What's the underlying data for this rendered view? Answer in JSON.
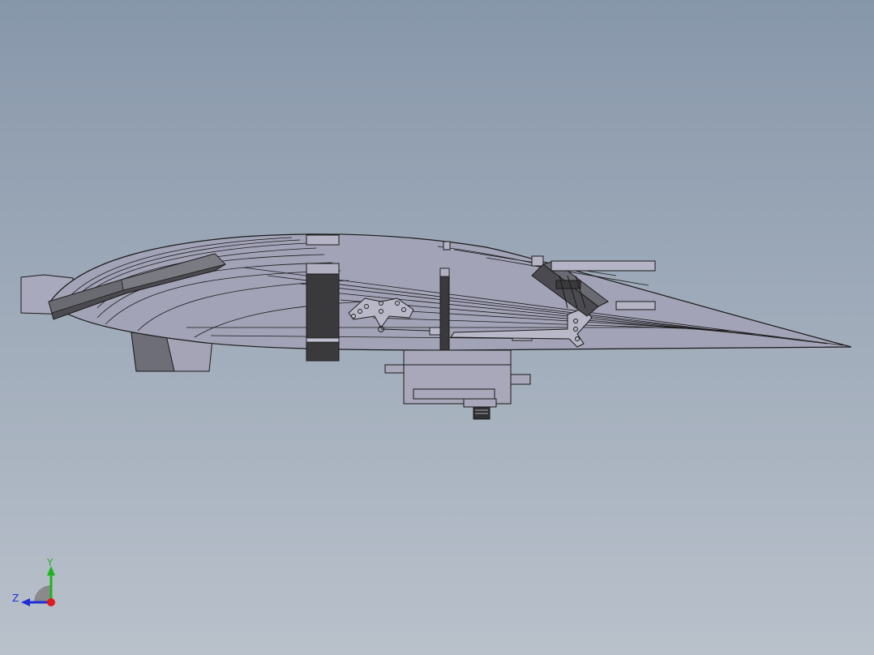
{
  "viewport": {
    "background_top": "#8797aa",
    "background_bottom": "#b9c1cb",
    "part_fill": "#a3a3b8",
    "dark_part_fill": "#3a3a3c",
    "edge_color": "#1a1a1a"
  },
  "triad": {
    "y_label": "Y",
    "z_label": "Z",
    "y_color": "#1fb41f",
    "z_color": "#1f2fd6",
    "x_color": "#e01a1a"
  }
}
